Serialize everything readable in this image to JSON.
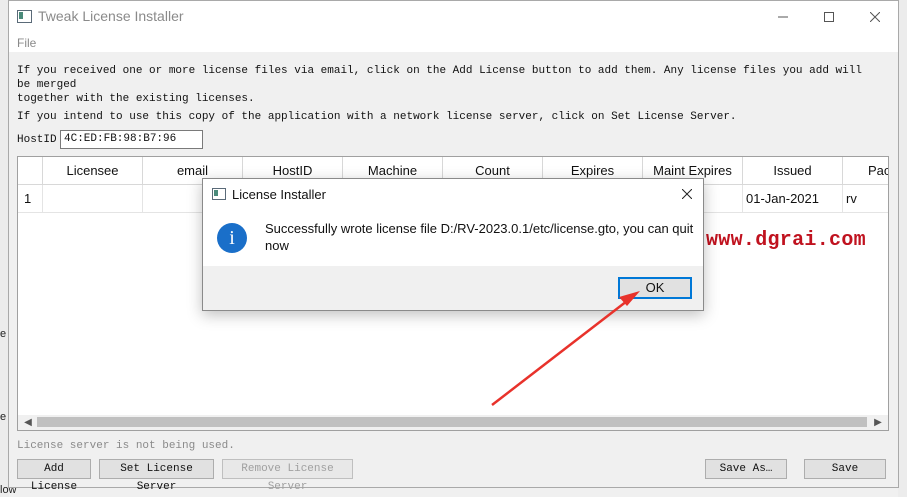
{
  "window": {
    "title": "Tweak License Installer",
    "menu": [
      "File"
    ],
    "info_line1": "If you received one or more license files via email, click on the Add License button to add them. Any license files you add will be merged",
    "info_line2": "together with the existing licenses.",
    "info_line3": "If you intend to use this copy of the application with a network license server, click on Set License Server.",
    "hostid_label": "HostID",
    "hostid_value": "4C:ED:FB:98:B7:96"
  },
  "table": {
    "columns": [
      "Licensee",
      "email",
      "HostID",
      "Machine",
      "Count",
      "Expires",
      "Maint Expires",
      "Issued",
      "Packa"
    ],
    "rows": [
      {
        "index": "1",
        "issued": "01-Jan-2021",
        "package": "rv"
      }
    ]
  },
  "status_text": "License server is not being used.",
  "buttons": {
    "add_license": "Add License",
    "set_license_server": "Set License Server",
    "remove_license_server": "Remove License Server",
    "save_as": "Save As…",
    "save": "Save"
  },
  "watermark": "www.dgrai.com",
  "dialog": {
    "title": "License Installer",
    "message": "Successfully wrote license file D:/RV-2023.0.1/etc/license.gto, you can quit now",
    "ok_label": "OK"
  },
  "background_fragments": [
    "e",
    "e",
    "low"
  ],
  "colors": {
    "accent": "#0078d7",
    "info_icon": "#1a6fc9",
    "watermark": "#c0121f",
    "arrow": "#e8322b"
  }
}
